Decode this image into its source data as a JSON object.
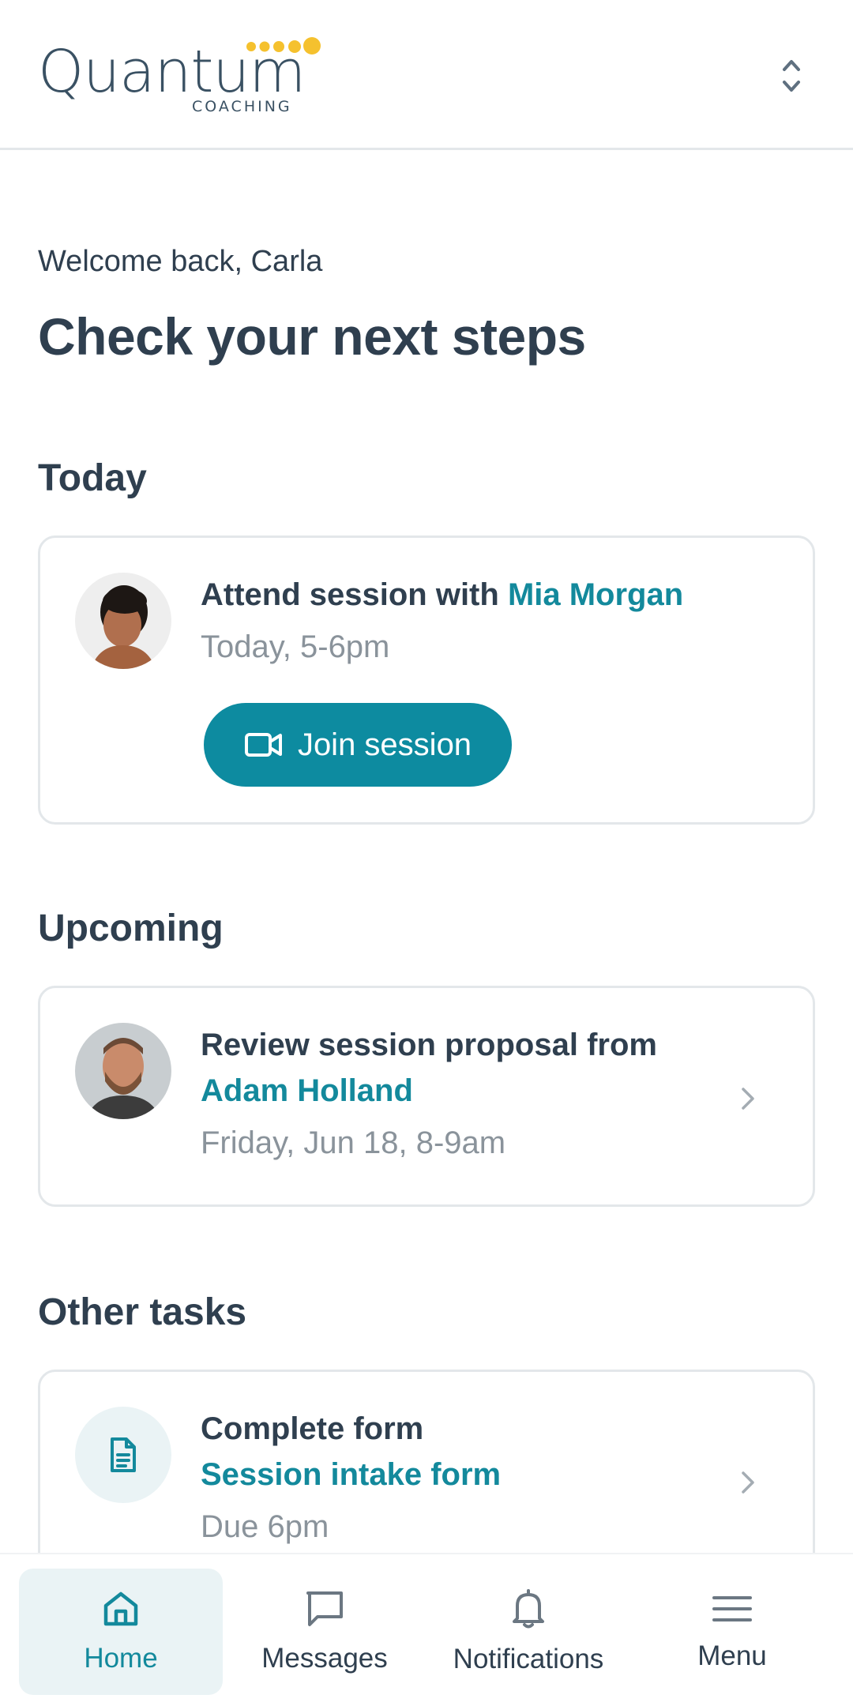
{
  "brand": {
    "logo_word": "Quantum",
    "logo_sub": "COACHING",
    "accent": "#13899c",
    "dot_color": "#f5c12e"
  },
  "header": {
    "switcher_icon": "chevron-up-down-icon"
  },
  "greeting": {
    "welcome": "Welcome back, Carla",
    "title": "Check your next steps"
  },
  "today": {
    "title": "Today",
    "card": {
      "action": "Attend session with",
      "coach": "Mia Morgan",
      "time": "Today, 5-6pm",
      "button_label": "Join session",
      "button_icon": "video-camera-icon"
    }
  },
  "upcoming": {
    "title": "Upcoming",
    "card": {
      "action": "Review session proposal from",
      "coach": "Adam Holland",
      "time": "Friday, Jun 18, 8-9am"
    }
  },
  "other": {
    "title": "Other tasks",
    "card": {
      "action": "Complete form",
      "form": "Session intake form",
      "due": "Due 6pm",
      "icon": "document-icon"
    }
  },
  "nav": {
    "items": [
      {
        "label": "Home",
        "icon": "home-icon",
        "active": true
      },
      {
        "label": "Messages",
        "icon": "chat-bubble-icon",
        "active": false
      },
      {
        "label": "Notifications",
        "icon": "bell-icon",
        "active": false
      },
      {
        "label": "Menu",
        "icon": "hamburger-menu-icon",
        "active": false
      }
    ]
  }
}
